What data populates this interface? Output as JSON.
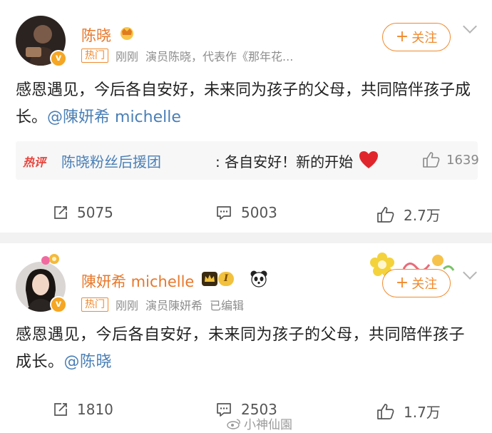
{
  "posts": [
    {
      "name": "陈晓",
      "hot_tag": "热门",
      "time": "刚刚",
      "bio": "演员陈晓，代表作《那年花...",
      "follow_label": "关注",
      "follow_plus": "+",
      "verified_mark": "v",
      "text": "感恩遇见，今后各自安好，未来同为孩子的父母，共同陪伴孩子成长。",
      "mention": "@陳妍希 michelle",
      "hot_comment": {
        "badge": "热评",
        "user": "陈晓粉丝后援团",
        "text": ": 各自安好！新的开始",
        "likes": "1639"
      },
      "reposts": "5075",
      "comments": "5003",
      "likes": "2.7万"
    },
    {
      "name": "陳妍希 michelle",
      "vip_level": "I",
      "hot_tag": "热门",
      "time": "刚刚",
      "bio": "演员陳妍希",
      "edited": "已编辑",
      "follow_label": "关注",
      "follow_plus": "+",
      "verified_mark": "v",
      "text": "感恩遇见，今后各自安好，未来同为孩子的父母，共同陪伴孩子成长。",
      "mention": "@陈晓",
      "reposts": "1810",
      "comments": "2503",
      "likes": "1.7万"
    }
  ],
  "watermark": "小神仙園",
  "colors": {
    "accent": "#f08a2e",
    "name": "#e8782b",
    "link": "#4a7fb6",
    "badge": "#f5a623"
  }
}
